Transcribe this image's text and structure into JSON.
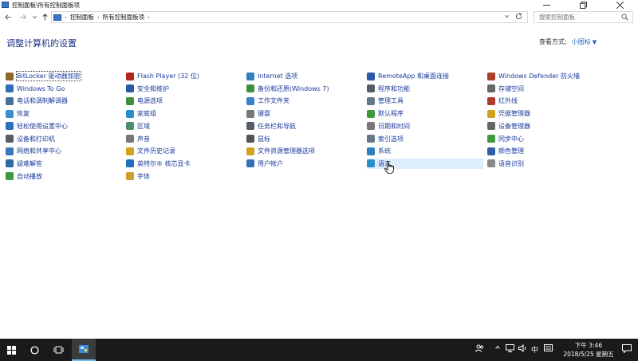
{
  "window": {
    "title": "控制面板\\所有控制面板项"
  },
  "address": {
    "crumbs": [
      "控制面板",
      "所有控制面板项"
    ]
  },
  "search": {
    "placeholder": "搜索控制面板"
  },
  "page": {
    "heading": "调整计算机的设置",
    "view_by_label": "查看方式:",
    "view_by_value": "小图标"
  },
  "columns": [
    [
      {
        "label": "BitLocker 驱动器加密",
        "icon": "bitlocker-icon",
        "color": "#8a6a2a"
      },
      {
        "label": "Windows To Go",
        "icon": "windows-to-go-icon",
        "color": "#2d6fb7"
      },
      {
        "label": "电话和调制解调器",
        "icon": "phone-modem-icon",
        "color": "#4b6f9a"
      },
      {
        "label": "恢复",
        "icon": "recovery-icon",
        "color": "#3b8fd1"
      },
      {
        "label": "轻松使用设置中心",
        "icon": "ease-of-access-icon",
        "color": "#2c6ec0"
      },
      {
        "label": "设备和打印机",
        "icon": "devices-printers-icon",
        "color": "#555d66"
      },
      {
        "label": "网络和共享中心",
        "icon": "network-sharing-icon",
        "color": "#3a77b8"
      },
      {
        "label": "疑难解答",
        "icon": "troubleshooting-icon",
        "color": "#2e6aa8"
      },
      {
        "label": "自动播放",
        "icon": "autoplay-icon",
        "color": "#3f9a3f"
      }
    ],
    [
      {
        "label": "Flash Player (32 位)",
        "icon": "flash-player-icon",
        "color": "#b0281c"
      },
      {
        "label": "安全和维护",
        "icon": "security-maintenance-icon",
        "color": "#2a5aa8"
      },
      {
        "label": "电源选项",
        "icon": "power-options-icon",
        "color": "#3f8f3f"
      },
      {
        "label": "家庭组",
        "icon": "homegroup-icon",
        "color": "#2a8fc9"
      },
      {
        "label": "区域",
        "icon": "region-icon",
        "color": "#4b8f6f"
      },
      {
        "label": "声音",
        "icon": "sound-icon",
        "color": "#777777"
      },
      {
        "label": "文件历史记录",
        "icon": "file-history-icon",
        "color": "#d1a21f"
      },
      {
        "label": "英特尔® 核芯显卡",
        "icon": "intel-graphics-icon",
        "color": "#1e6fc0"
      },
      {
        "label": "字体",
        "icon": "fonts-icon",
        "color": "#c9a227"
      }
    ],
    [
      {
        "label": "Internet 选项",
        "icon": "internet-options-icon",
        "color": "#2f7fc1"
      },
      {
        "label": "备份和还原(Windows 7)",
        "icon": "backup-restore-icon",
        "color": "#3f8f3f"
      },
      {
        "label": "工作文件夹",
        "icon": "work-folders-icon",
        "color": "#3a7fc8"
      },
      {
        "label": "键盘",
        "icon": "keyboard-icon",
        "color": "#777777"
      },
      {
        "label": "任务栏和导航",
        "icon": "taskbar-navigation-icon",
        "color": "#555d66"
      },
      {
        "label": "鼠标",
        "icon": "mouse-icon",
        "color": "#555555"
      },
      {
        "label": "文件资源管理器选项",
        "icon": "file-explorer-options-icon",
        "color": "#d1a21f"
      },
      {
        "label": "用户帐户",
        "icon": "user-accounts-icon",
        "color": "#3a6fb8"
      }
    ],
    [
      {
        "label": "RemoteApp 和桌面连接",
        "icon": "remoteapp-icon",
        "color": "#2a5aa8"
      },
      {
        "label": "程序和功能",
        "icon": "programs-features-icon",
        "color": "#555d66"
      },
      {
        "label": "管理工具",
        "icon": "admin-tools-icon",
        "color": "#667788"
      },
      {
        "label": "默认程序",
        "icon": "default-programs-icon",
        "color": "#3f9a3f"
      },
      {
        "label": "日期和时间",
        "icon": "date-time-icon",
        "color": "#777777"
      },
      {
        "label": "索引选项",
        "icon": "indexing-options-icon",
        "color": "#667788"
      },
      {
        "label": "系统",
        "icon": "system-icon",
        "color": "#2f7fc1"
      },
      {
        "label": "语言",
        "icon": "language-icon",
        "color": "#2a8fc9"
      }
    ],
    [
      {
        "label": "Windows Defender 防火墙",
        "icon": "firewall-icon",
        "color": "#a8402a"
      },
      {
        "label": "存储空间",
        "icon": "storage-spaces-icon",
        "color": "#666666"
      },
      {
        "label": "红外线",
        "icon": "infrared-icon",
        "color": "#b03a2e"
      },
      {
        "label": "凭据管理器",
        "icon": "credential-manager-icon",
        "color": "#d1a21f"
      },
      {
        "label": "设备管理器",
        "icon": "device-manager-icon",
        "color": "#666666"
      },
      {
        "label": "同步中心",
        "icon": "sync-center-icon",
        "color": "#3f9a3f"
      },
      {
        "label": "颜色管理",
        "icon": "color-management-icon",
        "color": "#2f5fa8"
      },
      {
        "label": "语音识别",
        "icon": "speech-recognition-icon",
        "color": "#888888"
      }
    ]
  ],
  "taskbar": {
    "ime": "中",
    "time": "下午 3:46",
    "date": "2018/5/25 星期五"
  }
}
